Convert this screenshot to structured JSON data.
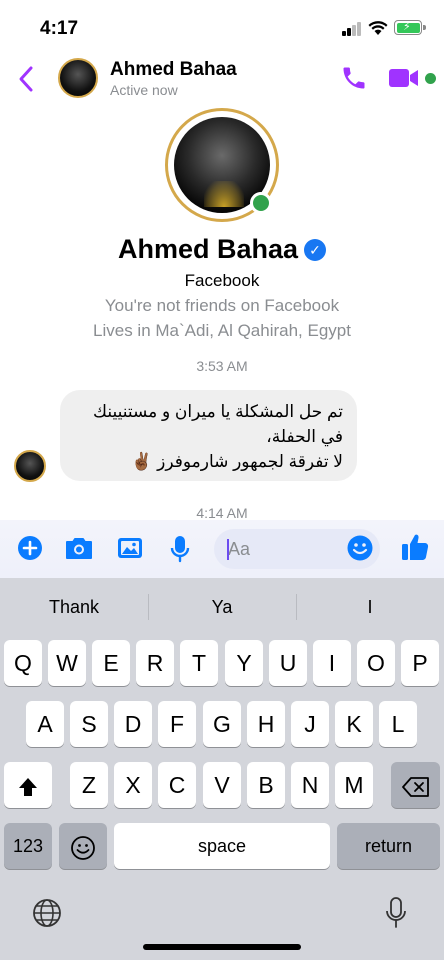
{
  "status_bar": {
    "time": "4:17"
  },
  "header": {
    "name": "Ahmed Bahaa",
    "status": "Active now"
  },
  "profile": {
    "name": "Ahmed Bahaa",
    "platform": "Facebook",
    "friend_status": "You're not friends on Facebook",
    "location": "Lives in Ma`Adi, Al Qahirah, Egypt"
  },
  "messages": {
    "timestamp_1": "3:53 AM",
    "message_1_line_1": "تم حل المشكلة يا ميران و مستنيينك",
    "message_1_line_2": "في الحفلة،",
    "message_1_line_3": "لا تفرقة لجمهور شارموفرز ✌🏾",
    "timestamp_2": "4:14 AM"
  },
  "composer": {
    "placeholder": "Aa"
  },
  "keyboard": {
    "suggestions": [
      "Thank",
      "Ya",
      "I"
    ],
    "row1": [
      "Q",
      "W",
      "E",
      "R",
      "T",
      "Y",
      "U",
      "I",
      "O",
      "P"
    ],
    "row2": [
      "A",
      "S",
      "D",
      "F",
      "G",
      "H",
      "J",
      "K",
      "L"
    ],
    "row3": [
      "Z",
      "X",
      "C",
      "V",
      "B",
      "N",
      "M"
    ],
    "numbers_label": "123",
    "space_label": "space",
    "return_label": "return"
  },
  "colors": {
    "accent_purple": "#a033ff",
    "messenger_blue": "#0a7cff",
    "online_green": "#31a24c",
    "gold_ring": "#d4a84b"
  },
  "icons": [
    "back-chevron-icon",
    "phone-icon",
    "video-camera-icon",
    "plus-icon",
    "camera-icon",
    "gallery-icon",
    "microphone-icon",
    "emoji-icon",
    "thumbs-up-icon",
    "shift-icon",
    "backspace-icon",
    "emoji-keyboard-icon",
    "globe-icon",
    "dictation-icon"
  ]
}
